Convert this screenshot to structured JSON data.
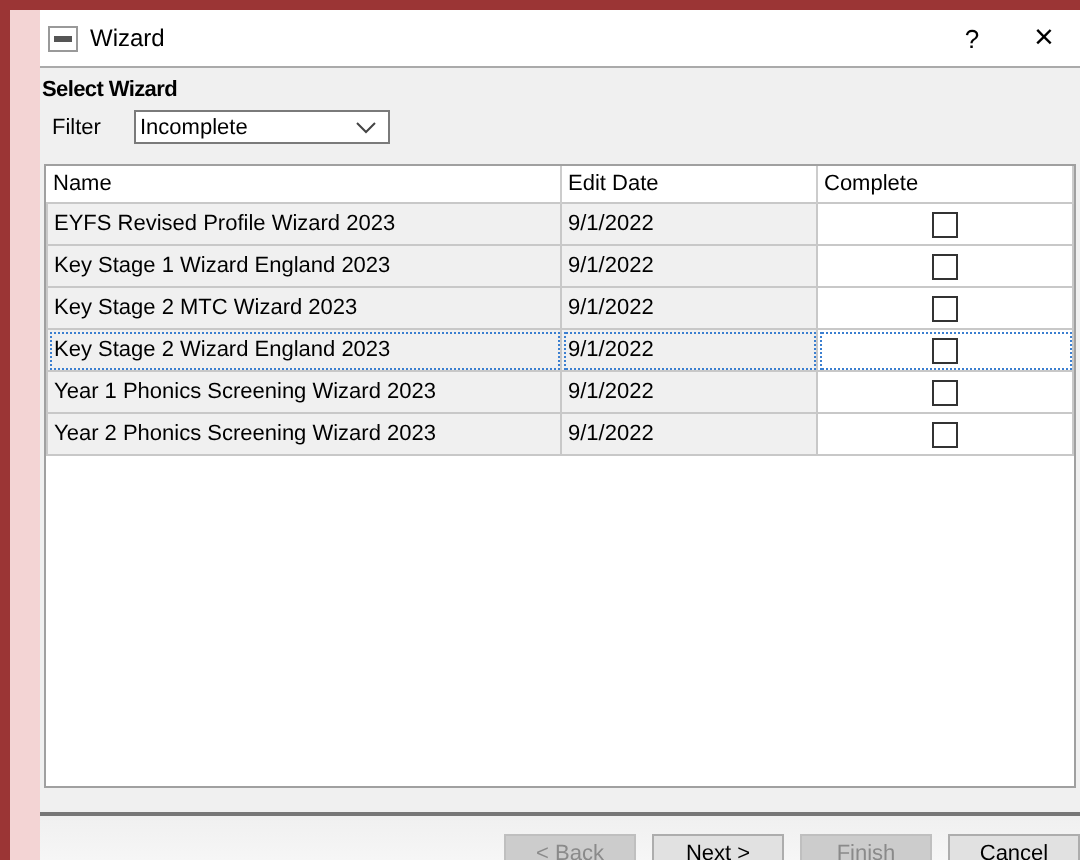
{
  "window": {
    "title": "Wizard",
    "help": "?",
    "close": "×"
  },
  "heading": "Select Wizard",
  "filter": {
    "label": "Filter",
    "value": "Incomplete"
  },
  "table": {
    "columns": [
      "Name",
      "Edit Date",
      "Complete"
    ],
    "rows": [
      {
        "name": "EYFS Revised Profile Wizard 2023",
        "date": "9/1/2022",
        "checked": false,
        "selected": false
      },
      {
        "name": "Key Stage 1 Wizard England 2023",
        "date": "9/1/2022",
        "checked": false,
        "selected": false
      },
      {
        "name": "Key Stage 2 MTC Wizard 2023",
        "date": "9/1/2022",
        "checked": false,
        "selected": false
      },
      {
        "name": "Key Stage 2 Wizard England 2023",
        "date": "9/1/2022",
        "checked": false,
        "selected": true
      },
      {
        "name": "Year 1 Phonics Screening Wizard 2023",
        "date": "9/1/2022",
        "checked": false,
        "selected": false
      },
      {
        "name": "Year 2 Phonics Screening Wizard 2023",
        "date": "9/1/2022",
        "checked": false,
        "selected": false
      }
    ]
  },
  "buttons": [
    {
      "label": "< Back",
      "disabled": true
    },
    {
      "label": "Next >",
      "disabled": false
    },
    {
      "label": "Finish",
      "disabled": true
    },
    {
      "label": "Cancel",
      "disabled": false
    }
  ]
}
